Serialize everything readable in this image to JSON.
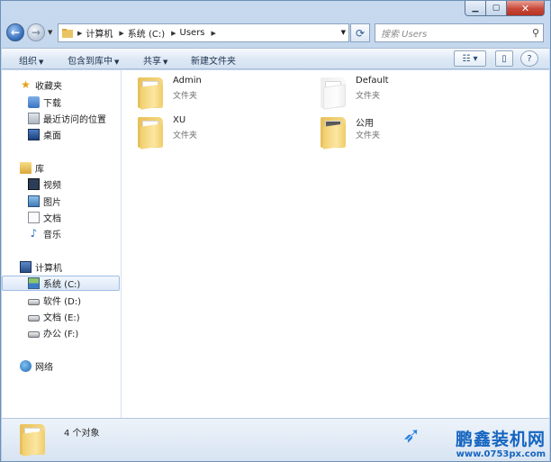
{
  "window": {
    "caption": {
      "min": "▁",
      "max": "▢",
      "close": "✕"
    }
  },
  "address_bar": {
    "breadcrumbs": [
      "计算机",
      "系统 (C:)",
      "Users"
    ],
    "search_placeholder": "搜索 Users"
  },
  "toolbar": {
    "organize": "组织",
    "include_in_library": "包含到库中",
    "share": "共享",
    "new_folder": "新建文件夹"
  },
  "nav": {
    "favorites": {
      "label": "收藏夹",
      "items": [
        "下载",
        "最近访问的位置",
        "桌面"
      ]
    },
    "libraries": {
      "label": "库",
      "items": [
        "视频",
        "图片",
        "文档",
        "音乐"
      ]
    },
    "computer": {
      "label": "计算机",
      "drives": [
        "系统 (C:)",
        "软件 (D:)",
        "文档 (E:)",
        "办公 (F:)"
      ],
      "selected": "系统 (C:)"
    },
    "network": {
      "label": "网络"
    }
  },
  "folders": [
    {
      "name": "Admin",
      "type": "文件夹"
    },
    {
      "name": "Default",
      "type": "文件夹"
    },
    {
      "name": "XU",
      "type": "文件夹"
    },
    {
      "name": "公用",
      "type": "文件夹"
    }
  ],
  "status": {
    "count_text": "4 个对象"
  },
  "watermark": {
    "brand": "鹏鑫装机网",
    "url": "www.0753px.com"
  },
  "colors": {
    "accent": "#1565c0",
    "selection": "#dbe8f7",
    "folder": "#f1cf6f"
  }
}
